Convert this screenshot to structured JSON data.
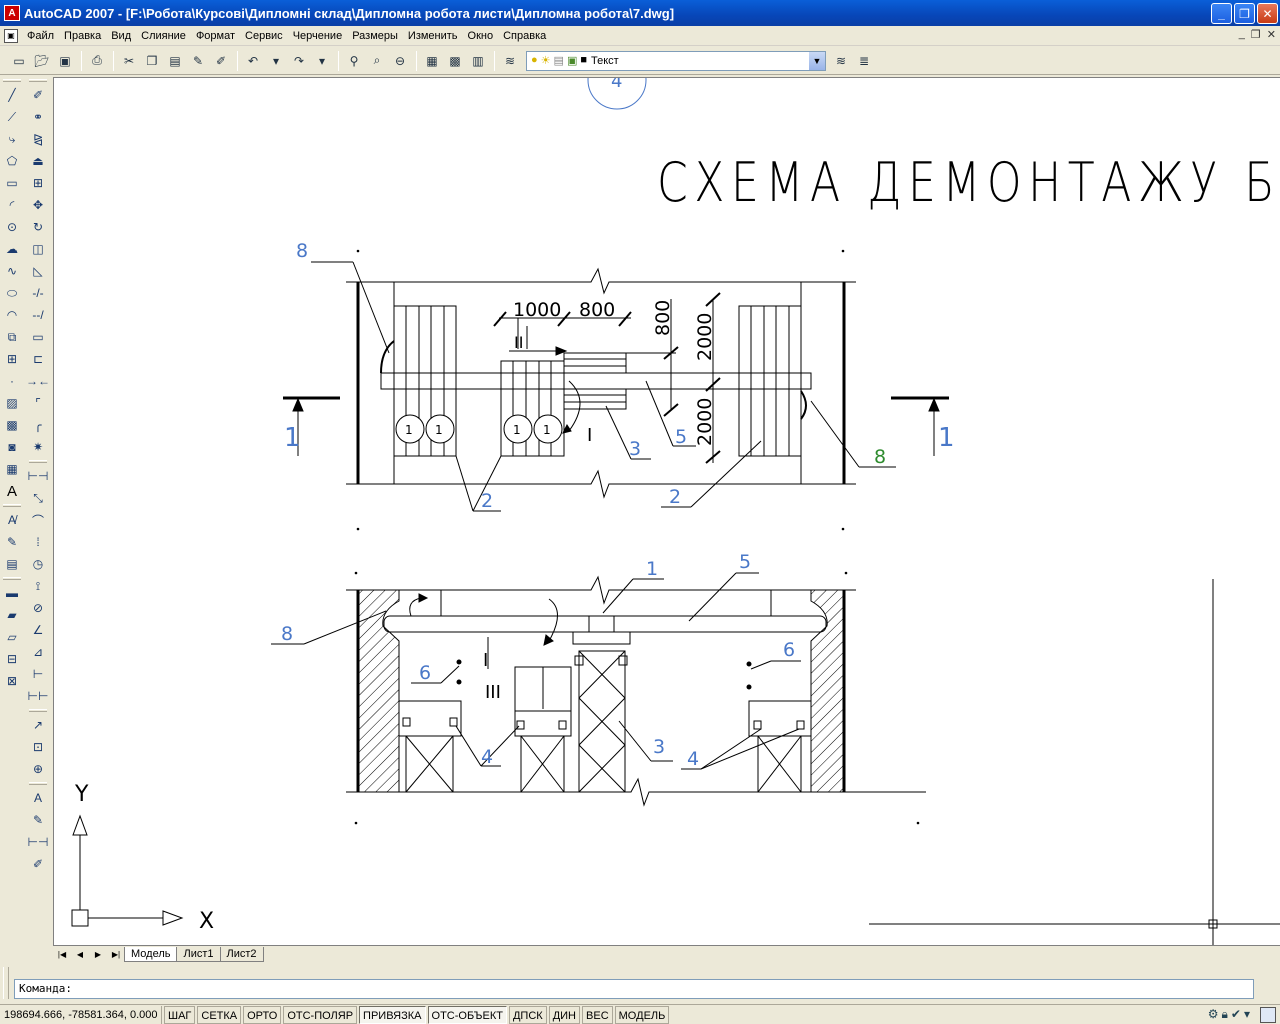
{
  "window": {
    "app_icon": "A",
    "title": "AutoCAD 2007 - [F:\\Робота\\Курсові\\Дипломні склад\\Дипломна робота листи\\Дипломна робота\\7.dwg]",
    "minimize": "_",
    "maximize": "❐",
    "close": "✕"
  },
  "menu": {
    "items": [
      "Файл",
      "Правка",
      "Вид",
      "Слияние",
      "Формат",
      "Сервис",
      "Черчение",
      "Размеры",
      "Изменить",
      "Окно",
      "Справка"
    ],
    "mdi_minimize": "_",
    "mdi_restore": "❐",
    "mdi_close": "✕"
  },
  "toolbar": {
    "buttons": [
      "new-icon",
      "open-icon",
      "save-icon",
      "print-icon",
      "cut-icon",
      "copy-icon",
      "paste-icon",
      "match-properties-icon",
      "brush-icon",
      "undo-icon",
      "redo-icon",
      "pan-icon",
      "zoom-realtime-icon",
      "zoom-window-icon",
      "zoom-previous-icon",
      "properties-icon",
      "design-center-icon",
      "calculator-icon"
    ],
    "layer_name": "Текст"
  },
  "drawing": {
    "title": "СХЕМА ДЕМОНТАЖУ Б",
    "circle_label": "4",
    "top_view": {
      "dim_1000": "1000",
      "dim_800_h": "800",
      "dim_800_v": "800",
      "dim_2000_a": "2000",
      "dim_2000_b": "2000",
      "roman_2": "II",
      "roman_1": "I",
      "callout_8_left": "8",
      "callout_8_right": "8",
      "callout_2a": "2",
      "callout_2b": "2",
      "callout_3": "3",
      "callout_5": "5",
      "section_left": "1",
      "section_right": "1",
      "bundle_label": "1"
    },
    "section_view": {
      "callout_1": "1",
      "callout_5": "5",
      "callout_8": "8",
      "callout_6a": "6",
      "callout_6b": "6",
      "callout_4a": "4",
      "callout_4b": "4",
      "callout_3": "3",
      "roman_3": "III",
      "roman_1": "I"
    },
    "ucs": {
      "x": "X",
      "y": "Y"
    }
  },
  "tabs": {
    "nav": [
      "|◀",
      "◀",
      "▶",
      "▶|"
    ],
    "items": [
      "Модель",
      "Лист1",
      "Лист2"
    ],
    "active": "Модель"
  },
  "command": {
    "prompt": "Команда:"
  },
  "status": {
    "coords": "198694.666, -78581.364, 0.000",
    "buttons": [
      {
        "label": "ШАГ",
        "on": false
      },
      {
        "label": "СЕТКА",
        "on": false
      },
      {
        "label": "ОРТО",
        "on": false
      },
      {
        "label": "ОТС-ПОЛЯР",
        "on": false
      },
      {
        "label": "ПРИВЯЗКА",
        "on": true
      },
      {
        "label": "ОТС-ОБЪЕКТ",
        "on": true
      },
      {
        "label": "ДПСК",
        "on": false
      },
      {
        "label": "ДИН",
        "on": false
      },
      {
        "label": "ВЕС",
        "on": false
      },
      {
        "label": "МОДЕЛЬ",
        "on": false
      }
    ]
  },
  "colors": {
    "title_bar": "#0746b8",
    "drawing_blue": "#4a78c8",
    "drawing_green": "#2e8b2e",
    "ink": "#000000"
  }
}
